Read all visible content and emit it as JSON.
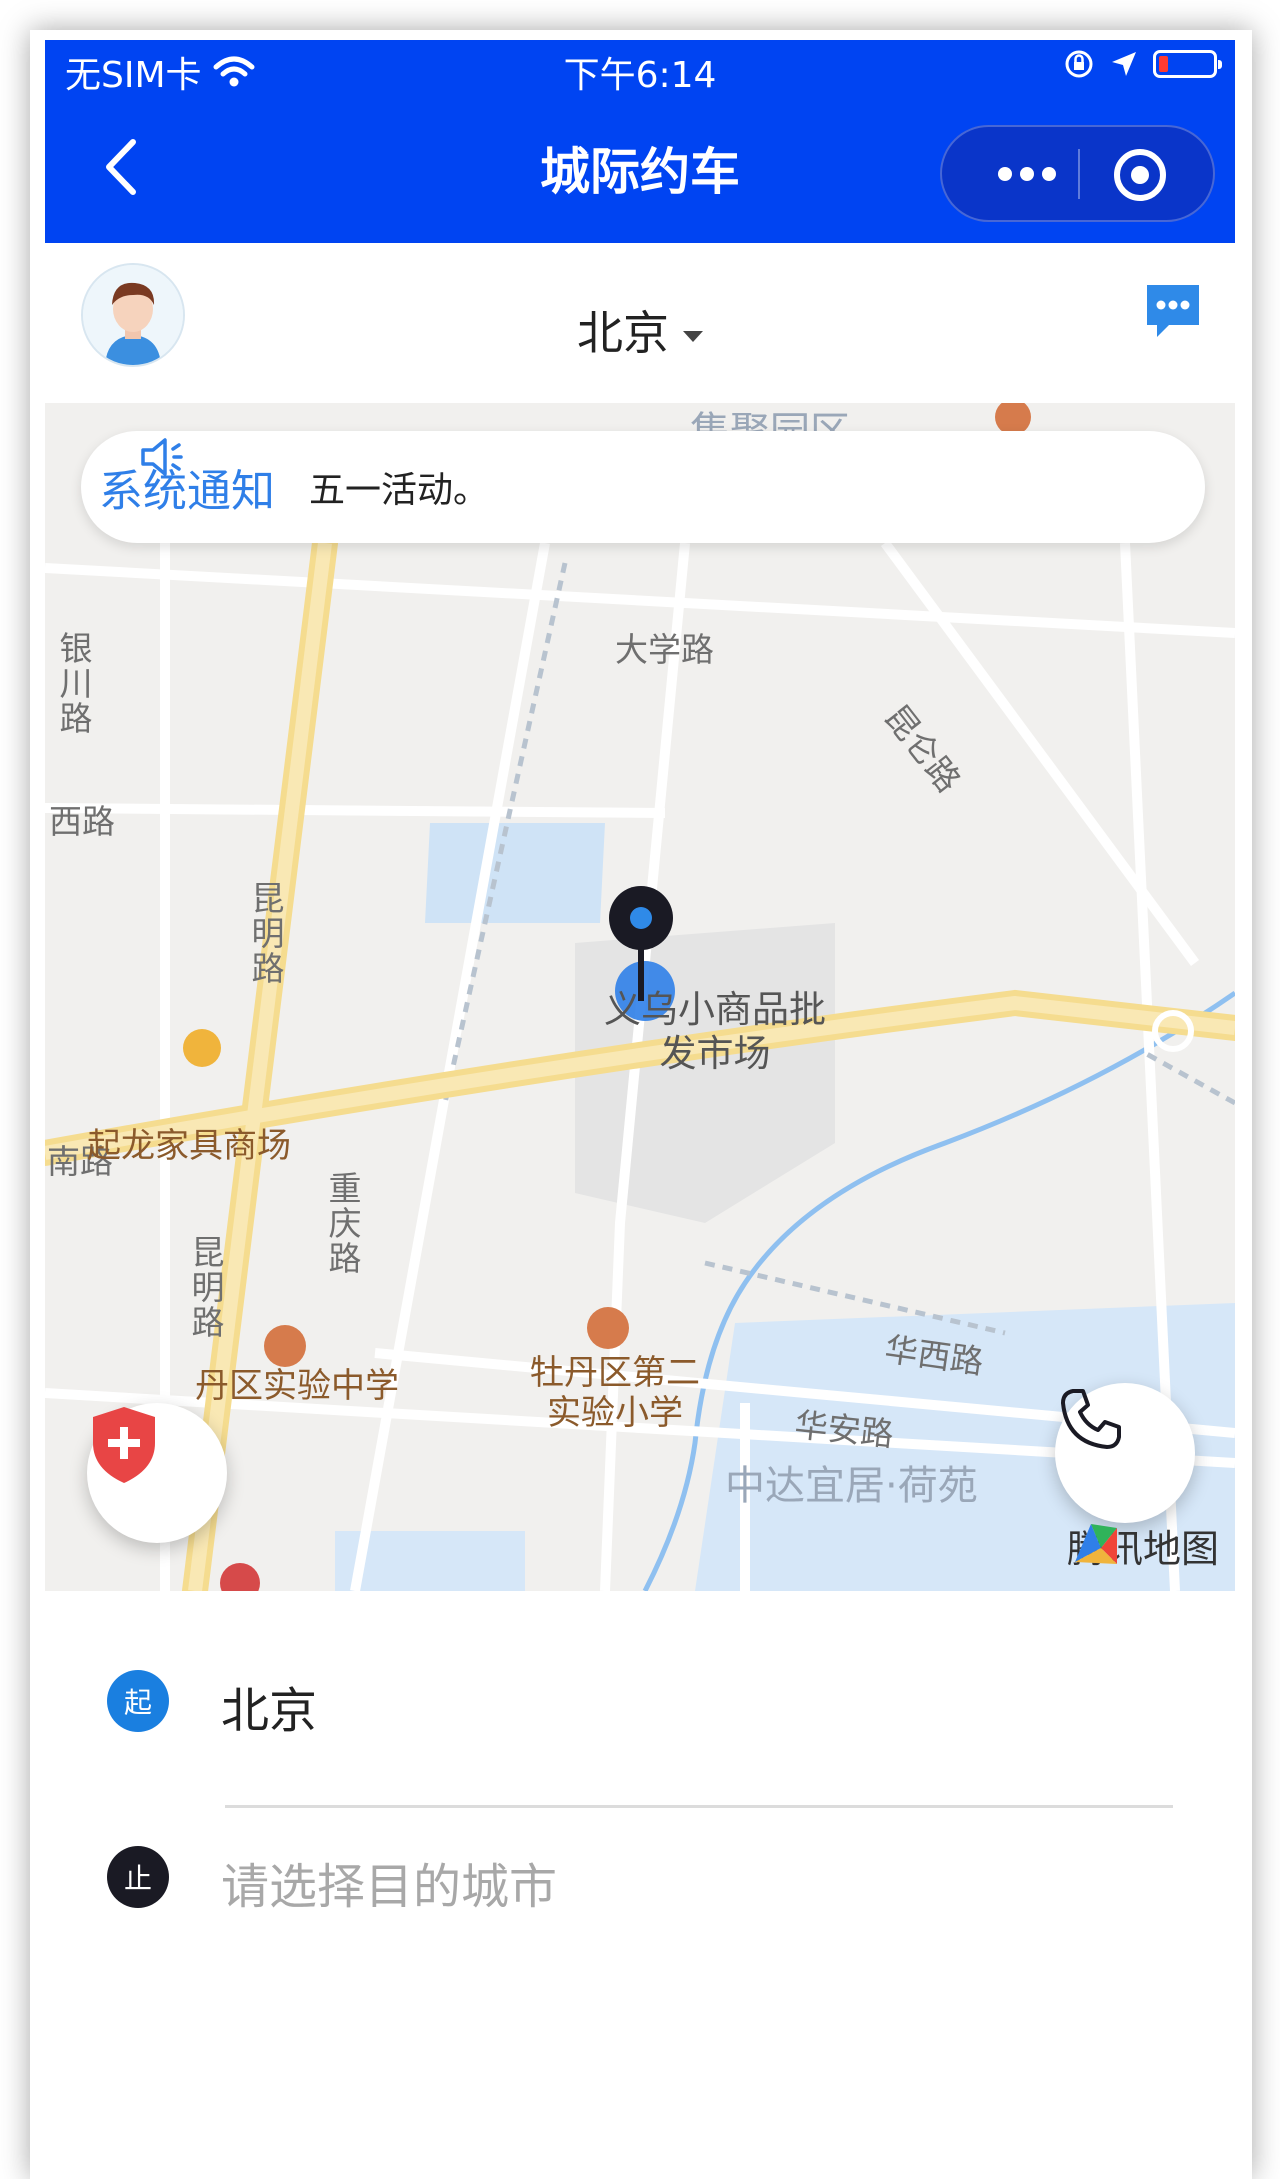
{
  "status_bar": {
    "carrier": "无SIM卡",
    "time": "下午6:14"
  },
  "nav": {
    "title": "城际约车",
    "back_icon": "chevron-left-icon",
    "more_icon": "more-dots-icon",
    "close_icon": "target-circle-icon",
    "bar_color": "#0044f2"
  },
  "header": {
    "city": "北京"
  },
  "notice": {
    "label": "系统通知",
    "message": "五一活动。"
  },
  "map": {
    "roads": [
      "大学路",
      "昆仑路",
      "银川路",
      "西路",
      "昆明路",
      "昆明路",
      "重庆路",
      "华西路",
      "华安路",
      "南路"
    ],
    "pois": [
      "义乌小商品批发市场",
      "起龙家具商场",
      "丹区实验中学",
      "牡丹区第二实验小学"
    ],
    "areas": [
      "中达宜居·荷苑",
      "集聚园区"
    ],
    "provider": "腾讯地图"
  },
  "route": {
    "start_badge": "起",
    "start_value": "北京",
    "end_badge": "止",
    "end_placeholder": "请选择目的城市",
    "start_color": "#1a7fe0",
    "end_color": "#1a1a24"
  }
}
